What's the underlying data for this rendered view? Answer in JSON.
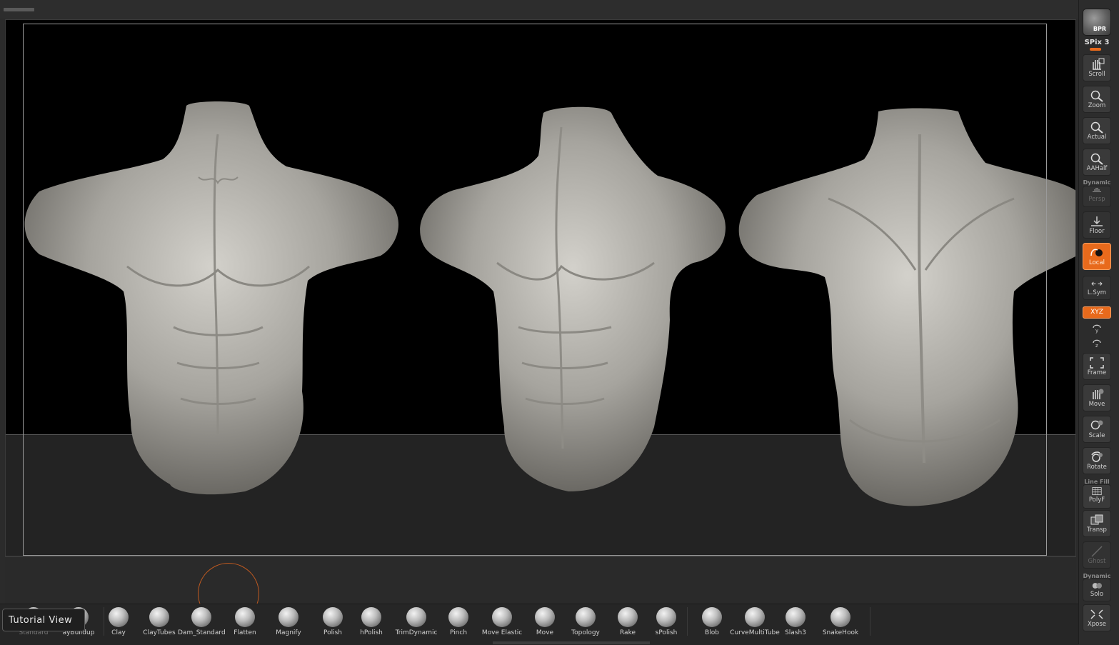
{
  "tutorial_label": "Tutorial View",
  "right_shelf": {
    "bpr": "BPR",
    "spix": "SPix 3",
    "scroll": "Scroll",
    "zoom": "Zoom",
    "actual": "Actual",
    "aahalf": "AAHalf",
    "dynamic_top": "Dynamic",
    "persp": "Persp",
    "floor": "Floor",
    "local": "Local",
    "lsym": "L.Sym",
    "xyz": "XYZ",
    "frame": "Frame",
    "move": "Move",
    "scale": "Scale",
    "rotate": "Rotate",
    "line_fill": "Line Fill",
    "polyf": "PolyF",
    "transp": "Transp",
    "ghost": "Ghost",
    "dynamic_bottom": "Dynamic",
    "solo": "Solo",
    "xpose": "Xpose"
  },
  "brushes": [
    {
      "label": "Standard"
    },
    {
      "label": "ayBuildup"
    },
    {
      "label": "Clay"
    },
    {
      "label": "ClayTubes"
    },
    {
      "label": "Dam_Standard"
    },
    {
      "label": "Flatten"
    },
    {
      "label": "Magnify"
    },
    {
      "label": "Polish"
    },
    {
      "label": "hPolish"
    },
    {
      "label": "TrimDynamic"
    },
    {
      "label": "Pinch"
    },
    {
      "label": "Move Elastic"
    },
    {
      "label": "Move"
    },
    {
      "label": "Topology"
    },
    {
      "label": "Rake"
    },
    {
      "label": "sPolish"
    },
    {
      "label": "Blob"
    },
    {
      "label": "CurveMultiTube"
    },
    {
      "label": "Slash3"
    },
    {
      "label": "SnakeHook"
    }
  ],
  "colors": {
    "accent": "#e86a1c",
    "canvas": "#000000",
    "floor": "#232323",
    "ui": "#2b2b2b"
  }
}
